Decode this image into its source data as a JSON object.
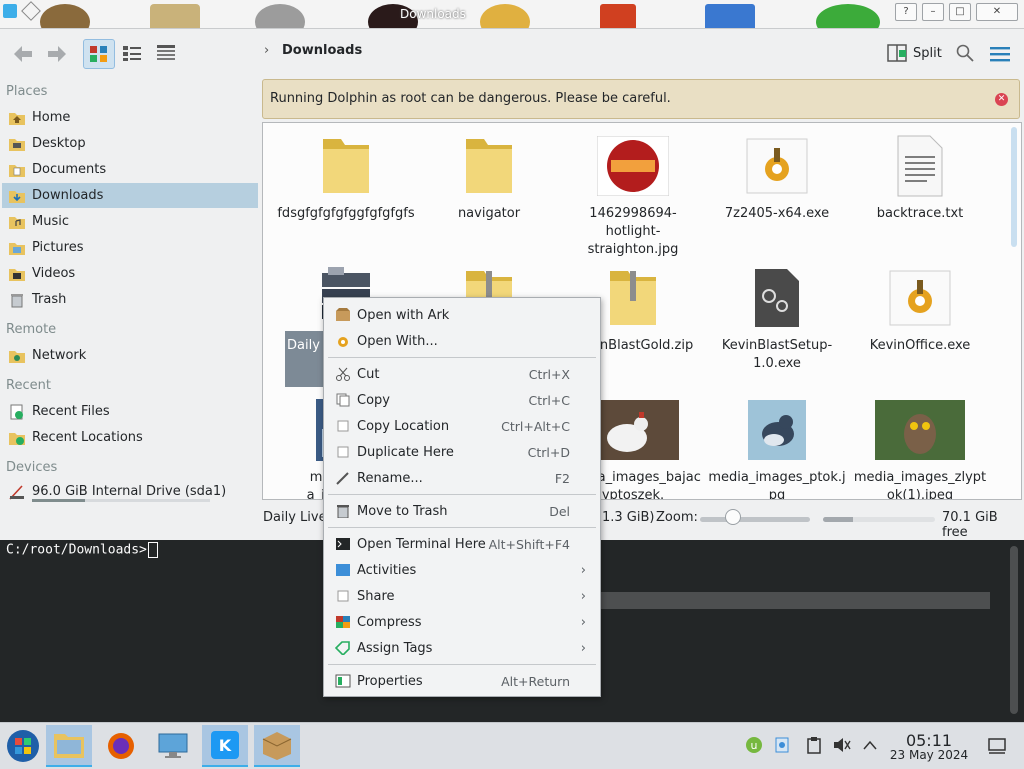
{
  "titlestrip": {
    "hover_title": "Downloads"
  },
  "toolbar": {
    "breadcrumb": "Downloads",
    "split_label": "Split"
  },
  "sidebar": {
    "sections": [
      {
        "title": "Places",
        "items": [
          {
            "label": "Home",
            "icon": "home-folder-icon"
          },
          {
            "label": "Desktop",
            "icon": "desktop-folder-icon"
          },
          {
            "label": "Documents",
            "icon": "documents-folder-icon"
          },
          {
            "label": "Downloads",
            "icon": "downloads-folder-icon",
            "selected": true
          },
          {
            "label": "Music",
            "icon": "music-folder-icon"
          },
          {
            "label": "Pictures",
            "icon": "pictures-folder-icon"
          },
          {
            "label": "Videos",
            "icon": "videos-folder-icon"
          },
          {
            "label": "Trash",
            "icon": "trash-icon"
          }
        ]
      },
      {
        "title": "Remote",
        "items": [
          {
            "label": "Network",
            "icon": "network-folder-icon"
          }
        ]
      },
      {
        "title": "Recent",
        "items": [
          {
            "label": "Recent Files",
            "icon": "recent-files-icon"
          },
          {
            "label": "Recent Locations",
            "icon": "recent-locations-icon"
          }
        ]
      },
      {
        "title": "Devices",
        "items": [
          {
            "label": "96.0 GiB Internal Drive (sda1)",
            "icon": "drive-icon",
            "usage_fraction": 0.3
          }
        ]
      }
    ]
  },
  "banner": {
    "text": "Running Dolphin as root can be dangerous. Please be careful."
  },
  "files": [
    {
      "name": "fdsgfgfgfgfggfgfgfgfs",
      "icon": "folder-icon"
    },
    {
      "name": "navigator",
      "icon": "folder-icon"
    },
    {
      "name": "1462998694-hotlight-straighton.jpg",
      "icon": "image-thumbnail-icon"
    },
    {
      "name": "7z2405-x64.exe",
      "icon": "exe-gear-icon"
    },
    {
      "name": "backtrace.txt",
      "icon": "text-file-icon"
    },
    {
      "name": "Daily Lives of My Countryside 1 (PC)",
      "icon": "archive-stack-icon",
      "selected": true
    },
    {
      "name": "",
      "icon": "zip-folder-icon"
    },
    {
      "name": "KevinBlastGold.zip",
      "icon": "zip-folder-icon"
    },
    {
      "name": "KevinBlastSetup-1.0.exe",
      "icon": "setup-gear-icon"
    },
    {
      "name": "KevinOffice.exe",
      "icon": "exe-gear-icon"
    },
    {
      "name": "media_images_jac",
      "icon": "image-thumbnail-icon"
    },
    {
      "name": "media_images_bajacyptoszek.",
      "icon": "chicken-image-icon"
    },
    {
      "name": "media_images_ptok.jpg",
      "icon": "bird-image-icon"
    },
    {
      "name": "media_images_zlyptok(1).jpeg",
      "icon": "owl-image-icon"
    }
  ],
  "statusbar": {
    "text": "Daily Lives",
    "size_text": "1.3 GiB)",
    "zoom_label": "Zoom:",
    "zoom_fraction": 0.3,
    "free_space_label": "70.1 GiB free",
    "used_fraction": 0.27
  },
  "terminal": {
    "prompt": "C:/root/Downloads>"
  },
  "context_menu": {
    "groups": [
      [
        {
          "label": "Open with Ark",
          "icon": "ark-icon"
        },
        {
          "label": "Open With...",
          "icon": "open-with-icon"
        }
      ],
      [
        {
          "label": "Cut",
          "shortcut": "Ctrl+X",
          "icon": "cut-icon"
        },
        {
          "label": "Copy",
          "shortcut": "Ctrl+C",
          "icon": "copy-icon"
        },
        {
          "label": "Copy Location",
          "shortcut": "Ctrl+Alt+C",
          "icon": "copy-location-icon"
        },
        {
          "label": "Duplicate Here",
          "shortcut": "Ctrl+D",
          "icon": "duplicate-icon"
        },
        {
          "label": "Rename...",
          "shortcut": "F2",
          "icon": "rename-icon"
        }
      ],
      [
        {
          "label": "Move to Trash",
          "shortcut": "Del",
          "icon": "trash-icon"
        }
      ],
      [
        {
          "label": "Open Terminal Here",
          "shortcut": "Alt+Shift+F4",
          "icon": "terminal-icon"
        },
        {
          "label": "Activities",
          "submenu": true,
          "icon": "activities-icon"
        },
        {
          "label": "Share",
          "submenu": true,
          "icon": "share-icon"
        },
        {
          "label": "Compress",
          "submenu": true,
          "icon": "compress-icon"
        },
        {
          "label": "Assign Tags",
          "submenu": true,
          "icon": "tag-icon"
        }
      ],
      [
        {
          "label": "Properties",
          "shortcut": "Alt+Return",
          "icon": "properties-icon"
        }
      ]
    ]
  },
  "taskbar": {
    "apps": [
      {
        "name": "start-menu-button",
        "icon": "windows-orb-icon"
      },
      {
        "name": "dolphin-task",
        "icon": "folder-icon",
        "active": true
      },
      {
        "name": "firefox-task",
        "icon": "firefox-icon"
      },
      {
        "name": "system-settings-task",
        "icon": "settings-monitor-icon"
      },
      {
        "name": "kde-task",
        "icon": "kde-logo-icon",
        "active": true
      },
      {
        "name": "ark-task",
        "icon": "ark-box-icon",
        "active": true
      }
    ],
    "tray": [
      "torrent-icon",
      "update-icon",
      "clipboard-icon",
      "mute-icon",
      "expand-tray-icon"
    ],
    "time": "05:11",
    "date": "23 May 2024"
  },
  "colors": {
    "selection": "#b6cfdf",
    "banner_bg": "#e9dfc4",
    "close_red": "#da4453",
    "accent": "#3daee9"
  }
}
